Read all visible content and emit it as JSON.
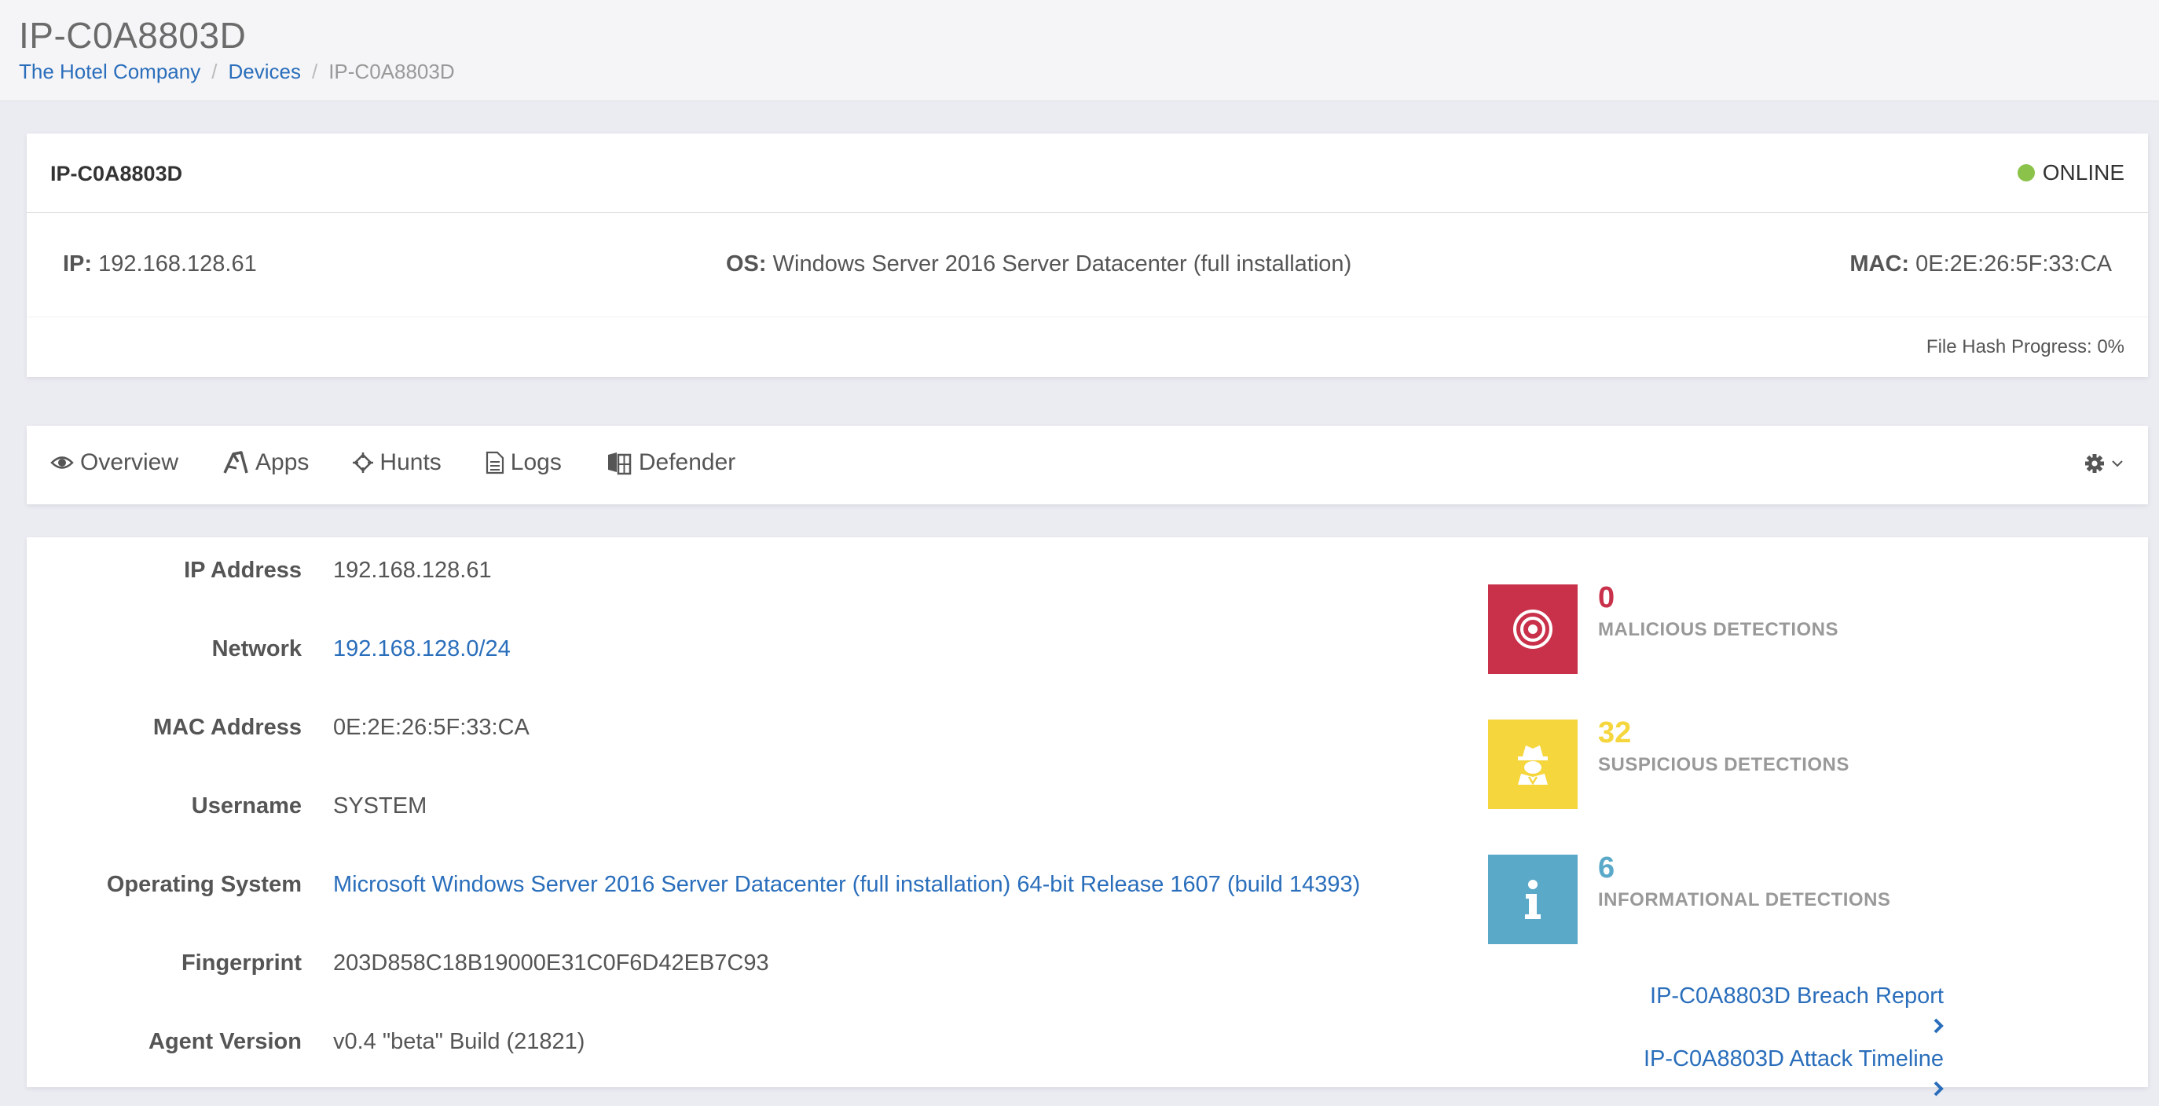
{
  "page": {
    "title": "IP-C0A8803D",
    "breadcrumb": [
      "The Hotel Company",
      "Devices",
      "IP-C0A8803D"
    ]
  },
  "device": {
    "hostname": "IP-C0A8803D",
    "status": "ONLINE",
    "status_color": "#8bc34a",
    "ip_label": "IP:",
    "ip": "192.168.128.61",
    "os_label": "OS:",
    "os": "Windows Server 2016 Server Datacenter (full installation)",
    "mac_label": "MAC:",
    "mac": "0E:2E:26:5F:33:CA",
    "file_hash_progress": "File Hash Progress: 0%"
  },
  "tabs": [
    {
      "label": "Overview",
      "icon": "eye-icon"
    },
    {
      "label": "Apps",
      "icon": "apps-icon"
    },
    {
      "label": "Hunts",
      "icon": "crosshair-icon"
    },
    {
      "label": "Logs",
      "icon": "document-icon"
    },
    {
      "label": "Defender",
      "icon": "windows-icon"
    }
  ],
  "properties": [
    {
      "label": "IP Address",
      "value": "192.168.128.61",
      "link": false
    },
    {
      "label": "Network",
      "value": "192.168.128.0/24",
      "link": true
    },
    {
      "label": "MAC Address",
      "value": "0E:2E:26:5F:33:CA",
      "link": false
    },
    {
      "label": "Username",
      "value": "SYSTEM",
      "link": false
    },
    {
      "label": "Operating System",
      "value": "Microsoft Windows Server 2016 Server Datacenter (full installation) 64-bit Release 1607 (build 14393)",
      "link": true
    },
    {
      "label": "Fingerprint",
      "value": "203D858C18B19000E31C0F6D42EB7C93",
      "link": false
    },
    {
      "label": "Agent Version",
      "value": "v0.4 \"beta\" Build (21821)",
      "link": false
    }
  ],
  "detections": [
    {
      "count": "0",
      "label": "MALICIOUS DETECTIONS",
      "color": "#c9314a",
      "icon": "target-icon"
    },
    {
      "count": "32",
      "label": "SUSPICIOUS DETECTIONS",
      "color": "#f5d63d",
      "icon": "spy-icon"
    },
    {
      "count": "6",
      "label": "INFORMATIONAL DETECTIONS",
      "color": "#5aa9c9",
      "icon": "info-icon"
    }
  ],
  "links": {
    "breach_report": "IP-C0A8803D Breach Report",
    "attack_timeline": "IP-C0A8803D Attack Timeline"
  }
}
